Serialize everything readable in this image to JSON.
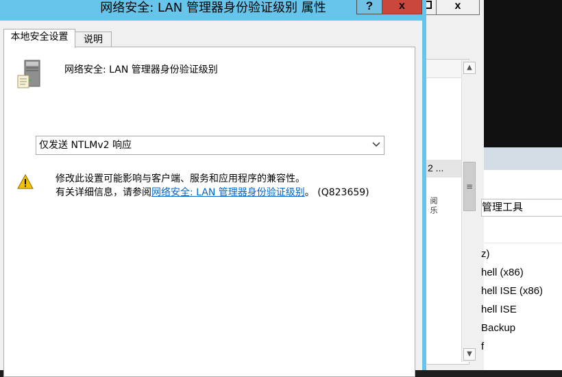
{
  "dialog": {
    "title": "网络安全: LAN 管理器身份验证级别 属性",
    "help_label": "?",
    "close_label": "x",
    "tabs": [
      {
        "label": "本地安全设置"
      },
      {
        "label": "说明"
      }
    ],
    "policy_title": "网络安全: LAN 管理器身份验证级别",
    "selected_option": "仅发送 NTLMv2 响应",
    "warning": {
      "line1": "修改此设置可能影响与客户端、服务和应用程序的兼容性。",
      "line2_prefix": "有关详细信息，请参阅",
      "link_text": "网络安全: LAN 管理器身份验证级别",
      "line2_suffix": "。 (Q823659)"
    }
  },
  "background_window": {
    "close_label": "x",
    "row_text": "2 ...",
    "fragment_text": "阅 乐"
  },
  "right_panel": {
    "path_text": "管理工具",
    "items": [
      "z)",
      "hell (x86)",
      "hell ISE (x86)",
      "hell ISE",
      "Backup",
      "f"
    ]
  },
  "colors": {
    "title_bar": "#67c4ea",
    "close_button": "#c9483b",
    "link": "#0066cc"
  }
}
